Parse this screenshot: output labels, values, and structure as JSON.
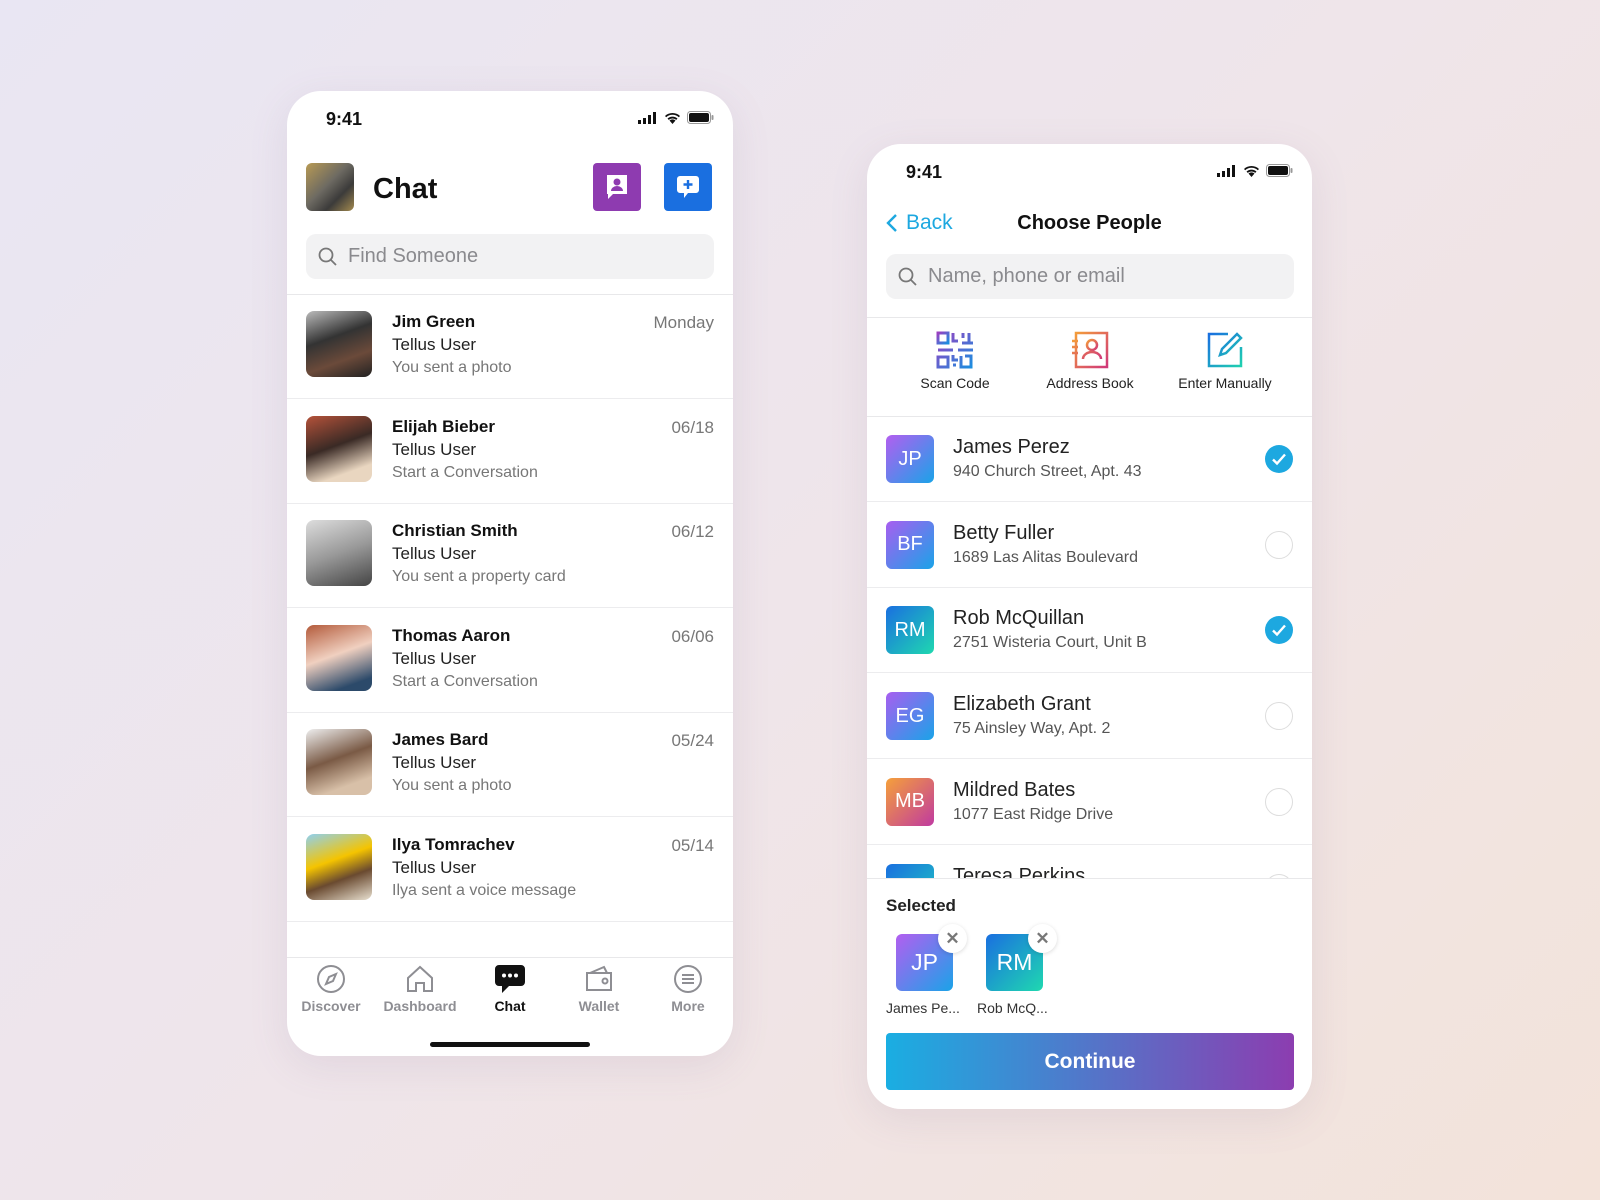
{
  "chat_screen": {
    "time": "9:41",
    "title": "Chat",
    "search_placeholder": "Find Someone",
    "conversations": [
      {
        "name": "Jim Green",
        "type": "Tellus User",
        "message": "You sent a photo",
        "date": "Monday"
      },
      {
        "name": "Elijah Bieber",
        "type": "Tellus User",
        "message": "Start a Conversation",
        "date": "06/18"
      },
      {
        "name": "Christian Smith",
        "type": "Tellus User",
        "message": "You sent a property card",
        "date": "06/12"
      },
      {
        "name": "Thomas Aaron",
        "type": "Tellus User",
        "message": "Start a Conversation",
        "date": "06/06"
      },
      {
        "name": "James Bard",
        "type": "Tellus User",
        "message": "You sent a photo",
        "date": "05/24"
      },
      {
        "name": "Ilya Tomrachev",
        "type": "Tellus User",
        "message": "Ilya sent a voice message",
        "date": "05/14"
      }
    ],
    "tabs": [
      {
        "label": "Discover",
        "icon": "compass-icon"
      },
      {
        "label": "Dashboard",
        "icon": "home-icon"
      },
      {
        "label": "Chat",
        "icon": "chat-bubble-icon",
        "active": true
      },
      {
        "label": "Wallet",
        "icon": "wallet-icon"
      },
      {
        "label": "More",
        "icon": "menu-icon"
      }
    ],
    "colors": {
      "contacts_button": "#8e3bb0",
      "new_chat_button": "#1a6fe0"
    }
  },
  "choose_screen": {
    "time": "9:41",
    "back": "Back",
    "title": "Choose People",
    "search_placeholder": "Name, phone or email",
    "actions": [
      {
        "label": "Scan Code",
        "icon": "qr-code-icon"
      },
      {
        "label": "Address Book",
        "icon": "address-book-icon"
      },
      {
        "label": "Enter Manually",
        "icon": "edit-icon"
      }
    ],
    "people": [
      {
        "initials": "JP",
        "name": "James Perez",
        "address": "940 Church Street, Apt. 43",
        "selected": true
      },
      {
        "initials": "BF",
        "name": "Betty Fuller",
        "address": "1689 Las Alitas Boulevard",
        "selected": false
      },
      {
        "initials": "RM",
        "name": "Rob McQuillan",
        "address": "2751 Wisteria Court, Unit B",
        "selected": true
      },
      {
        "initials": "EG",
        "name": "Elizabeth Grant",
        "address": "75 Ainsley Way, Apt. 2",
        "selected": false
      },
      {
        "initials": "MB",
        "name": "Mildred Bates",
        "address": "1077 East Ridge Drive",
        "selected": false
      },
      {
        "initials": "",
        "name": "Teresa Perkins",
        "address": "",
        "selected": false
      }
    ],
    "selected_label": "Selected",
    "selected": [
      {
        "initials": "JP",
        "label": "James Pe..."
      },
      {
        "initials": "RM",
        "label": "Rob McQ..."
      }
    ],
    "continue": "Continue",
    "accent": "#1da8e0"
  }
}
